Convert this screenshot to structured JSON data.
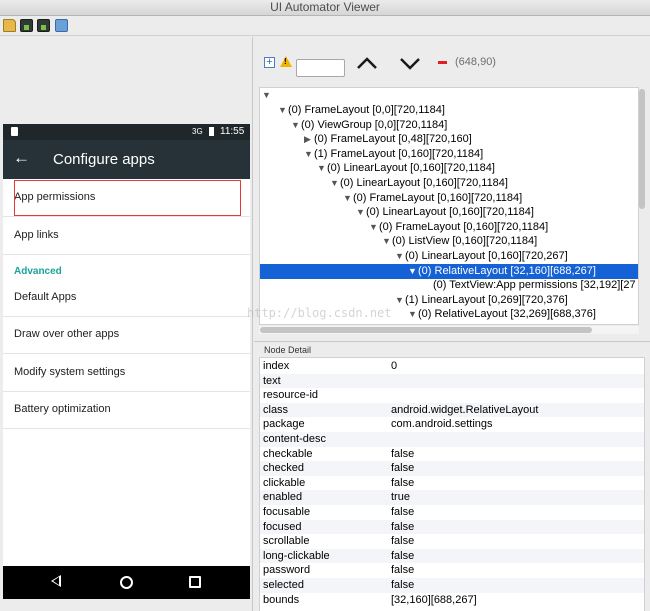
{
  "window": {
    "title": "UI Automator Viewer"
  },
  "toolbar": {
    "icons": [
      "open-folder-icon",
      "device-screenshot-icon",
      "device-screenshot-compressed-icon",
      "save-icon"
    ]
  },
  "device": {
    "status_bar": {
      "signal": "3G",
      "time": "11:55"
    },
    "app_bar": {
      "title": "Configure apps"
    },
    "items": [
      {
        "label": "App permissions"
      },
      {
        "label": "App links"
      },
      {
        "label": "Default Apps"
      },
      {
        "label": "Draw over other apps"
      },
      {
        "label": "Modify system settings"
      },
      {
        "label": "Battery optimization"
      }
    ],
    "section_header": "Advanced"
  },
  "hierarchy": {
    "coords": "(648,90)",
    "nodes": [
      {
        "text": "(0) FrameLayout [0,0][720,1184]",
        "arrow": "▼"
      },
      {
        "text": "(0) ViewGroup [0,0][720,1184]",
        "arrow": "▼"
      },
      {
        "text": "(0) FrameLayout [0,48][720,160]",
        "arrow": "▶"
      },
      {
        "text": "(1) FrameLayout [0,160][720,1184]",
        "arrow": "▼"
      },
      {
        "text": "(0) LinearLayout [0,160][720,1184]",
        "arrow": "▼"
      },
      {
        "text": "(0) LinearLayout [0,160][720,1184]",
        "arrow": "▼"
      },
      {
        "text": "(0) FrameLayout [0,160][720,1184]",
        "arrow": "▼"
      },
      {
        "text": "(0) LinearLayout [0,160][720,1184]",
        "arrow": "▼"
      },
      {
        "text": "(0) FrameLayout [0,160][720,1184]",
        "arrow": "▼"
      },
      {
        "text": "(0) ListView [0,160][720,1184]",
        "arrow": "▼"
      },
      {
        "text": "(0) LinearLayout [0,160][720,267]",
        "arrow": "▼"
      },
      {
        "text": "(0) RelativeLayout [32,160][688,267]",
        "arrow": "▼"
      },
      {
        "text": "(0) TextView:App permissions [32,192][27",
        "arrow": ""
      },
      {
        "text": "(1) LinearLayout [0,269][720,376]",
        "arrow": "▼"
      },
      {
        "text": "(0) RelativeLayout [32,269][688,376]",
        "arrow": "▼"
      }
    ],
    "watermark": "http://blog.csdn.net"
  },
  "node_detail": {
    "header": "Node Detail",
    "rows": [
      {
        "key": "index",
        "value": "0"
      },
      {
        "key": "text",
        "value": ""
      },
      {
        "key": "resource-id",
        "value": ""
      },
      {
        "key": "class",
        "value": "android.widget.RelativeLayout"
      },
      {
        "key": "package",
        "value": "com.android.settings"
      },
      {
        "key": "content-desc",
        "value": ""
      },
      {
        "key": "checkable",
        "value": "false"
      },
      {
        "key": "checked",
        "value": "false"
      },
      {
        "key": "clickable",
        "value": "false"
      },
      {
        "key": "enabled",
        "value": "true"
      },
      {
        "key": "focusable",
        "value": "false"
      },
      {
        "key": "focused",
        "value": "false"
      },
      {
        "key": "scrollable",
        "value": "false"
      },
      {
        "key": "long-clickable",
        "value": "false"
      },
      {
        "key": "password",
        "value": "false"
      },
      {
        "key": "selected",
        "value": "false"
      },
      {
        "key": "bounds",
        "value": "[32,160][688,267]"
      }
    ]
  },
  "colors": {
    "selection": "#1561d6",
    "highlight_box": "#e53935",
    "accent_teal": "#1aa39a",
    "app_bar": "#263238"
  }
}
